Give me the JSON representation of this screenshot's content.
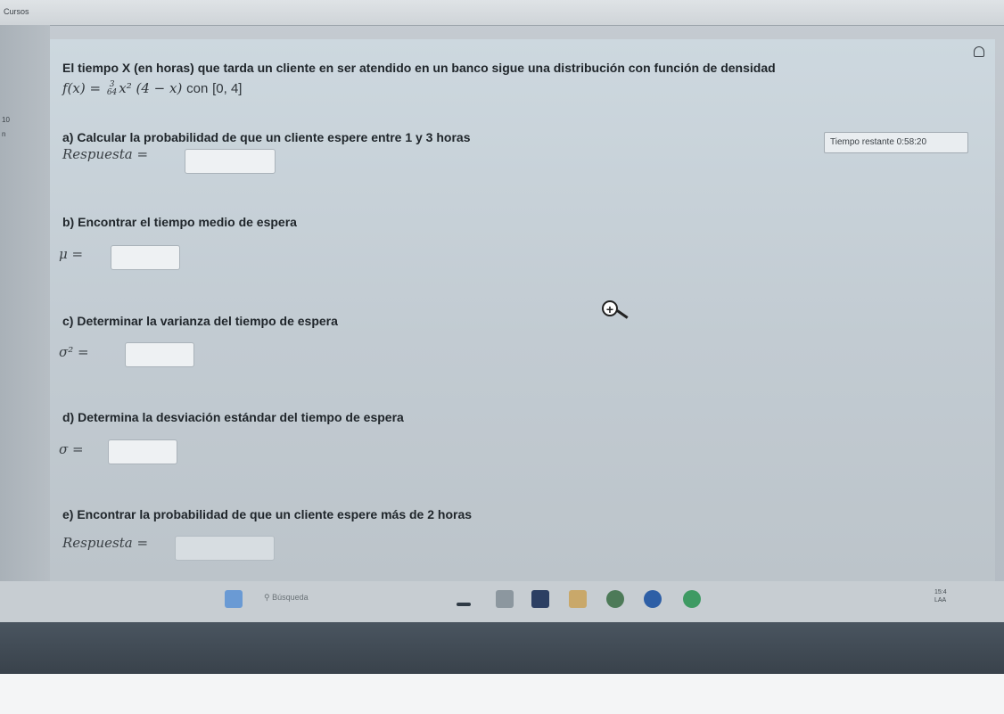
{
  "app": {
    "title": "Cursos"
  },
  "timer": {
    "text": "Tiempo restante 0:58:20"
  },
  "problem": {
    "statement": "El tiempo X (en horas) que tarda un cliente en ser atendido en un banco sigue una distribución con función de densidad",
    "density_lhs": "f(x) = ",
    "density_num": "3",
    "density_den": "64",
    "density_rhs": "x² (4 − x)",
    "density_con": "con",
    "density_domain": "[0, 4]"
  },
  "questions": [
    {
      "text": "a) Calcular la probabilidad de que un cliente espere entre 1 y 3 horas",
      "answer_label": "Respuesta =",
      "answer_value": ""
    },
    {
      "text": "b) Encontrar el tiempo medio de espera",
      "answer_label": "μ =",
      "answer_value": ""
    },
    {
      "text": "c) Determinar la varianza del tiempo de espera",
      "answer_label": "σ² =",
      "answer_value": ""
    },
    {
      "text": "d) Determina la desviación estándar del tiempo de espera",
      "answer_label": "σ =",
      "answer_value": ""
    },
    {
      "text": "e) Encontrar la probabilidad de que un cliente espere más de 2 horas",
      "answer_label": "Respuesta =",
      "answer_value": ""
    }
  ],
  "taskbar": {
    "search_placeholder": "Búsqueda",
    "clock_line1": "15:4",
    "clock_line2": "LAA"
  },
  "colors": {
    "panel": "#c8d2d9",
    "text": "#20262b",
    "taskbar": "#c7cdd2",
    "bezel": "#3f4952"
  }
}
